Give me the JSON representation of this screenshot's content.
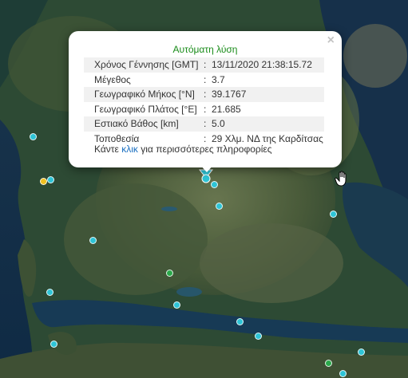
{
  "popup": {
    "title": "Αυτόματη λύση",
    "close_symbol": "×",
    "rows": [
      {
        "label": "Χρόνος Γέννησης [GMT]",
        "sep": ":",
        "value": "13/11/2020 21:38:15.72"
      },
      {
        "label": "Μέγεθος",
        "sep": ":",
        "value": "3.7"
      },
      {
        "label": "Γεωγραφικό Μήκος [°N]",
        "sep": ":",
        "value": "39.1767"
      },
      {
        "label": "Γεωγραφικό Πλάτος [°E]",
        "sep": ":",
        "value": "21.685"
      },
      {
        "label": "Εστιακό Βάθος [km]",
        "sep": ":",
        "value": "5.0"
      },
      {
        "label": "Τοποθεσία",
        "sep": ":",
        "value": "29 Χλμ. ΝΔ της Καρδίτσας"
      }
    ],
    "more_prefix": "Κάντε",
    "more_link": "κλικ",
    "more_suffix": "για περισσότερες πληροφορίες"
  },
  "colors": {
    "marker_cyan": "#2ec4d6",
    "marker_green": "#2aa84a",
    "marker_yellow": "#f0c020",
    "title_green": "#1a8c1a",
    "link_blue": "#1a6fc0"
  },
  "icons": {
    "main_marker": "earthquake-epicenter-icon",
    "cursor": "hand-pointer-icon",
    "close": "close-icon"
  }
}
